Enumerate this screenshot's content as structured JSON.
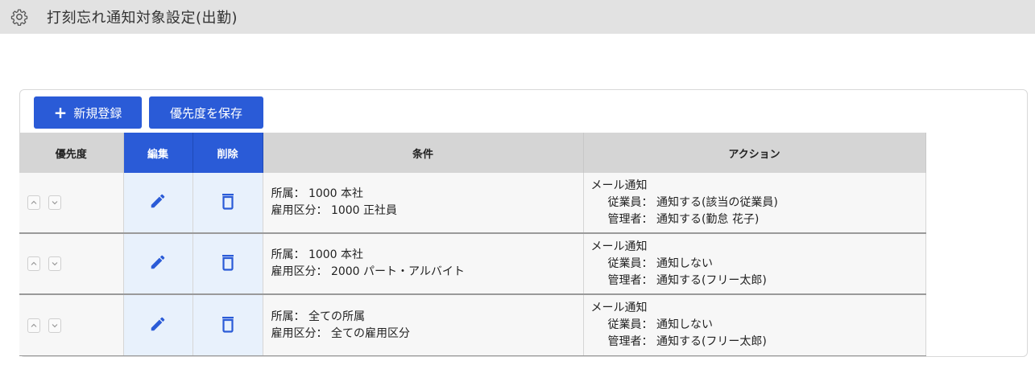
{
  "header": {
    "title": "打刻忘れ通知対象設定(出勤)",
    "icon": "gear-icon"
  },
  "toolbar": {
    "new_label": "新規登録",
    "save_priority_label": "優先度を保存"
  },
  "table": {
    "columns": {
      "priority": "優先度",
      "edit": "編集",
      "delete": "削除",
      "condition": "条件",
      "action": "アクション"
    },
    "rows": [
      {
        "cond_dept": "所属： 1000 本社",
        "cond_emp": "雇用区分： 1000 正社員",
        "act_title": "メール通知",
        "act_staff": "従業員： 通知する(該当の従業員)",
        "act_admin": "管理者： 通知する(勤怠 花子)"
      },
      {
        "cond_dept": "所属： 1000 本社",
        "cond_emp": "雇用区分： 2000 パート・アルバイト",
        "act_title": "メール通知",
        "act_staff": "従業員： 通知しない",
        "act_admin": "管理者： 通知する(フリー太郎)"
      },
      {
        "cond_dept": "所属： 全ての所属",
        "cond_emp": "雇用区分： 全ての雇用区分",
        "act_title": "メール通知",
        "act_staff": "従業員： 通知しない",
        "act_admin": "管理者： 通知する(フリー太郎)"
      }
    ]
  },
  "colors": {
    "accent": "#2a5bd7",
    "header_bar": "#e2e2e2",
    "edit_column_bg": "#e8f1fc"
  }
}
